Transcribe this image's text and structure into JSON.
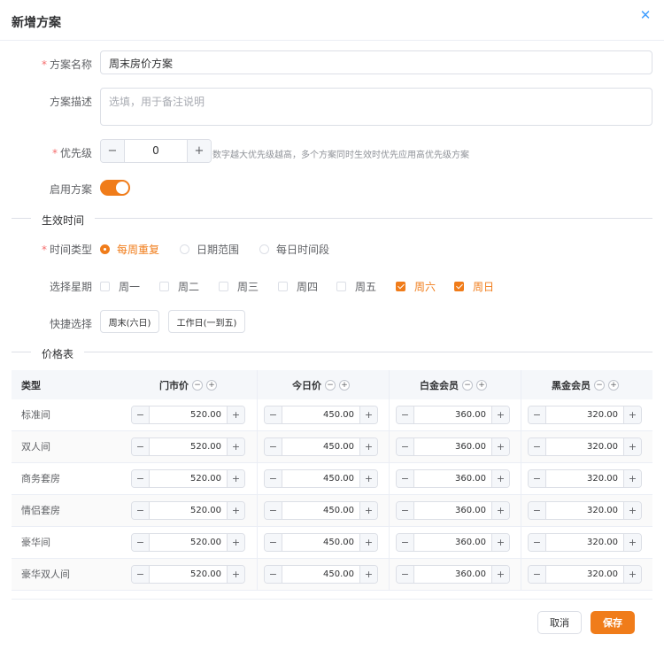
{
  "dialog": {
    "title": "新增方案",
    "close_icon": "close-icon"
  },
  "form": {
    "name_label": "方案名称",
    "name_value": "周末房价方案",
    "desc_label": "方案描述",
    "desc_placeholder": "选填，用于备注说明",
    "priority_label": "优先级",
    "priority_value": "0",
    "priority_minus": "−",
    "priority_plus": "+",
    "priority_hint": "数字越大优先级越高，多个方案同时生效时优先应用高优先级方案",
    "enable_label": "启用方案",
    "enabled": true
  },
  "effective": {
    "section_title": "生效时间",
    "time_type_label": "时间类型",
    "time_types": [
      "每周重复",
      "日期范围",
      "每日时间段"
    ],
    "time_type_selected": 0,
    "weekday_label": "选择星期",
    "weekdays": [
      "周一",
      "周二",
      "周三",
      "周四",
      "周五",
      "周六",
      "周日"
    ],
    "weekdays_checked": [
      false,
      false,
      false,
      false,
      false,
      true,
      true
    ],
    "quick_label": "快捷选择",
    "quick_buttons": [
      "周末(六日)",
      "工作日(一到五)"
    ]
  },
  "price_table": {
    "section_title": "价格表",
    "col_type": "类型",
    "columns": [
      "门市价",
      "今日价",
      "白金会员",
      "黑金会员"
    ],
    "mini_minus": "−",
    "mini_plus": "+",
    "rows": [
      {
        "name": "标准间",
        "prices": [
          "520.00",
          "450.00",
          "360.00",
          "320.00"
        ]
      },
      {
        "name": "双人间",
        "prices": [
          "520.00",
          "450.00",
          "360.00",
          "320.00"
        ]
      },
      {
        "name": "商务套房",
        "prices": [
          "520.00",
          "450.00",
          "360.00",
          "320.00"
        ]
      },
      {
        "name": "情侣套房",
        "prices": [
          "520.00",
          "450.00",
          "360.00",
          "320.00"
        ]
      },
      {
        "name": "豪华间",
        "prices": [
          "520.00",
          "450.00",
          "360.00",
          "320.00"
        ]
      },
      {
        "name": "豪华双人间",
        "prices": [
          "520.00",
          "450.00",
          "360.00",
          "320.00"
        ]
      }
    ]
  },
  "footer": {
    "cancel": "取消",
    "save": "保存"
  },
  "colors": {
    "accent": "#f07c1a",
    "required": "#f56c6c",
    "close": "#409eff"
  }
}
